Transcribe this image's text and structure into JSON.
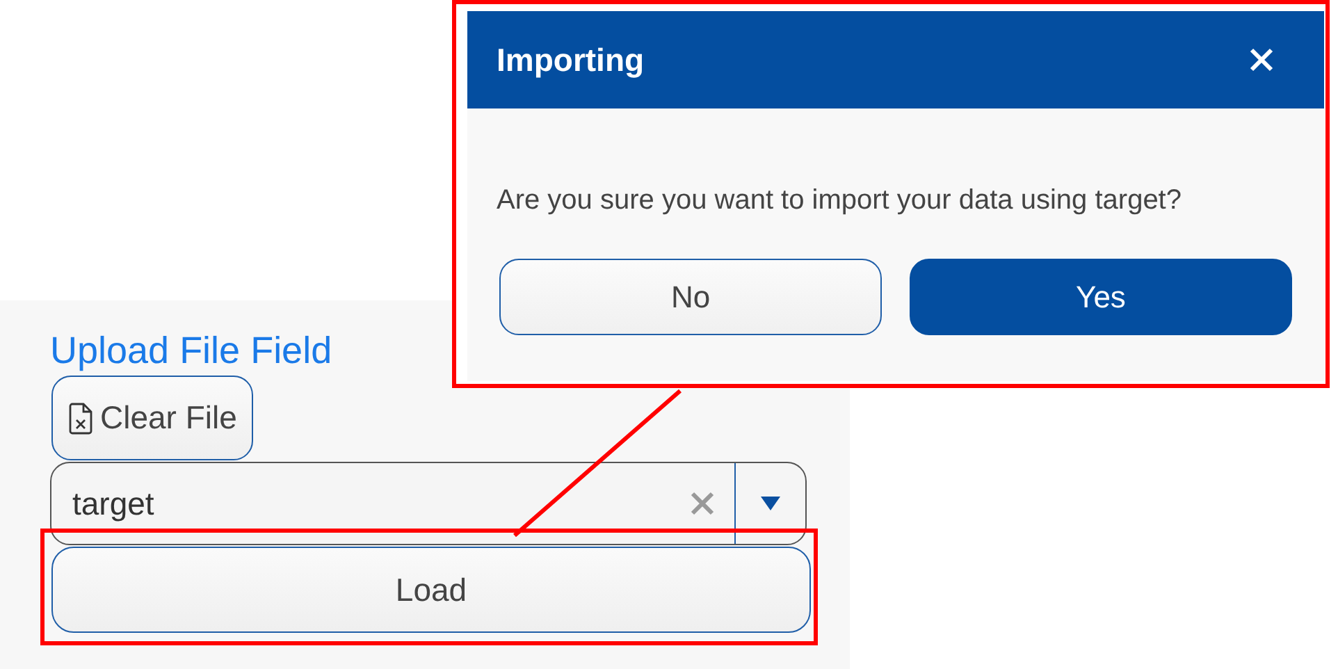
{
  "upload": {
    "title": "Upload File Field",
    "clear_button": "Clear File",
    "field": {
      "value": "target"
    },
    "load_button": "Load"
  },
  "dialog": {
    "title": "Importing",
    "message": "Are you sure you want to import your data using target?",
    "buttons": [
      {
        "label": "No",
        "kind": "secondary"
      },
      {
        "label": "Yes",
        "kind": "primary"
      }
    ]
  }
}
